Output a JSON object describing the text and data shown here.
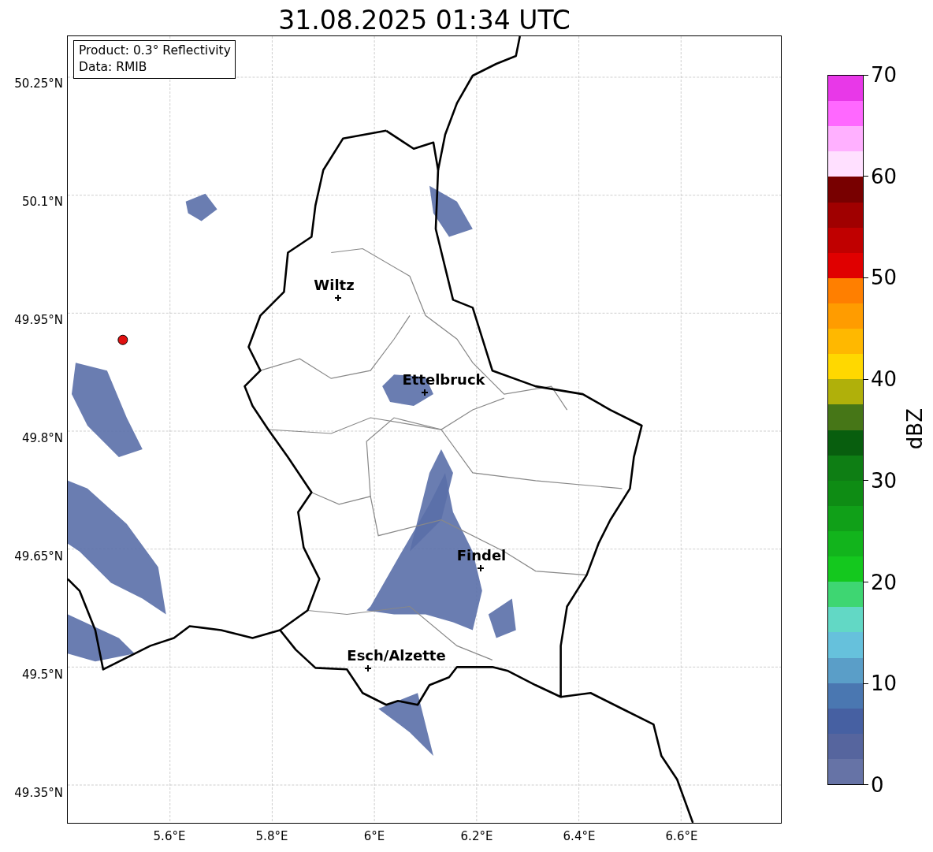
{
  "title": "31.08.2025 01:34 UTC",
  "info_box": {
    "lines": [
      "Product: 0.3° Reflectivity",
      "Data: RMIB"
    ]
  },
  "map": {
    "lat_ticks": [
      "50.25°N",
      "50.1°N",
      "49.95°N",
      "49.8°N",
      "49.65°N",
      "49.5°N",
      "49.35°N"
    ],
    "lon_ticks": [
      "5.6°E",
      "5.8°E",
      "6°E",
      "6.2°E",
      "6.4°E",
      "6.6°E"
    ],
    "cities": [
      {
        "name": "Wiltz"
      },
      {
        "name": "Ettelbruck"
      },
      {
        "name": "Findel"
      },
      {
        "name": "Esch/Alzette"
      }
    ]
  },
  "colorbar": {
    "label": "dBZ",
    "ticks": [
      "70",
      "60",
      "50",
      "40",
      "30",
      "20",
      "10",
      "0"
    ],
    "bands": [
      {
        "color": "#6673a6"
      },
      {
        "color": "#56659e"
      },
      {
        "color": "#4660a2"
      },
      {
        "color": "#4a77b1"
      },
      {
        "color": "#5a9ec8"
      },
      {
        "color": "#66c1dc"
      },
      {
        "color": "#62d8c5"
      },
      {
        "color": "#3ed672"
      },
      {
        "color": "#14c81e"
      },
      {
        "color": "#12b41c"
      },
      {
        "color": "#10a018"
      },
      {
        "color": "#0e8c14"
      },
      {
        "color": "#0e7e14"
      },
      {
        "color": "#085e0e"
      },
      {
        "color": "#467617"
      },
      {
        "color": "#b0b00a"
      },
      {
        "color": "#ffd800"
      },
      {
        "color": "#ffb800"
      },
      {
        "color": "#ff9c00"
      },
      {
        "color": "#ff7f00"
      },
      {
        "color": "#e00000"
      },
      {
        "color": "#c00000"
      },
      {
        "color": "#a00000"
      },
      {
        "color": "#780000"
      },
      {
        "color": "#ffe0ff"
      },
      {
        "color": "#ffb0ff"
      },
      {
        "color": "#ff68ff"
      },
      {
        "color": "#e838e8"
      }
    ]
  }
}
